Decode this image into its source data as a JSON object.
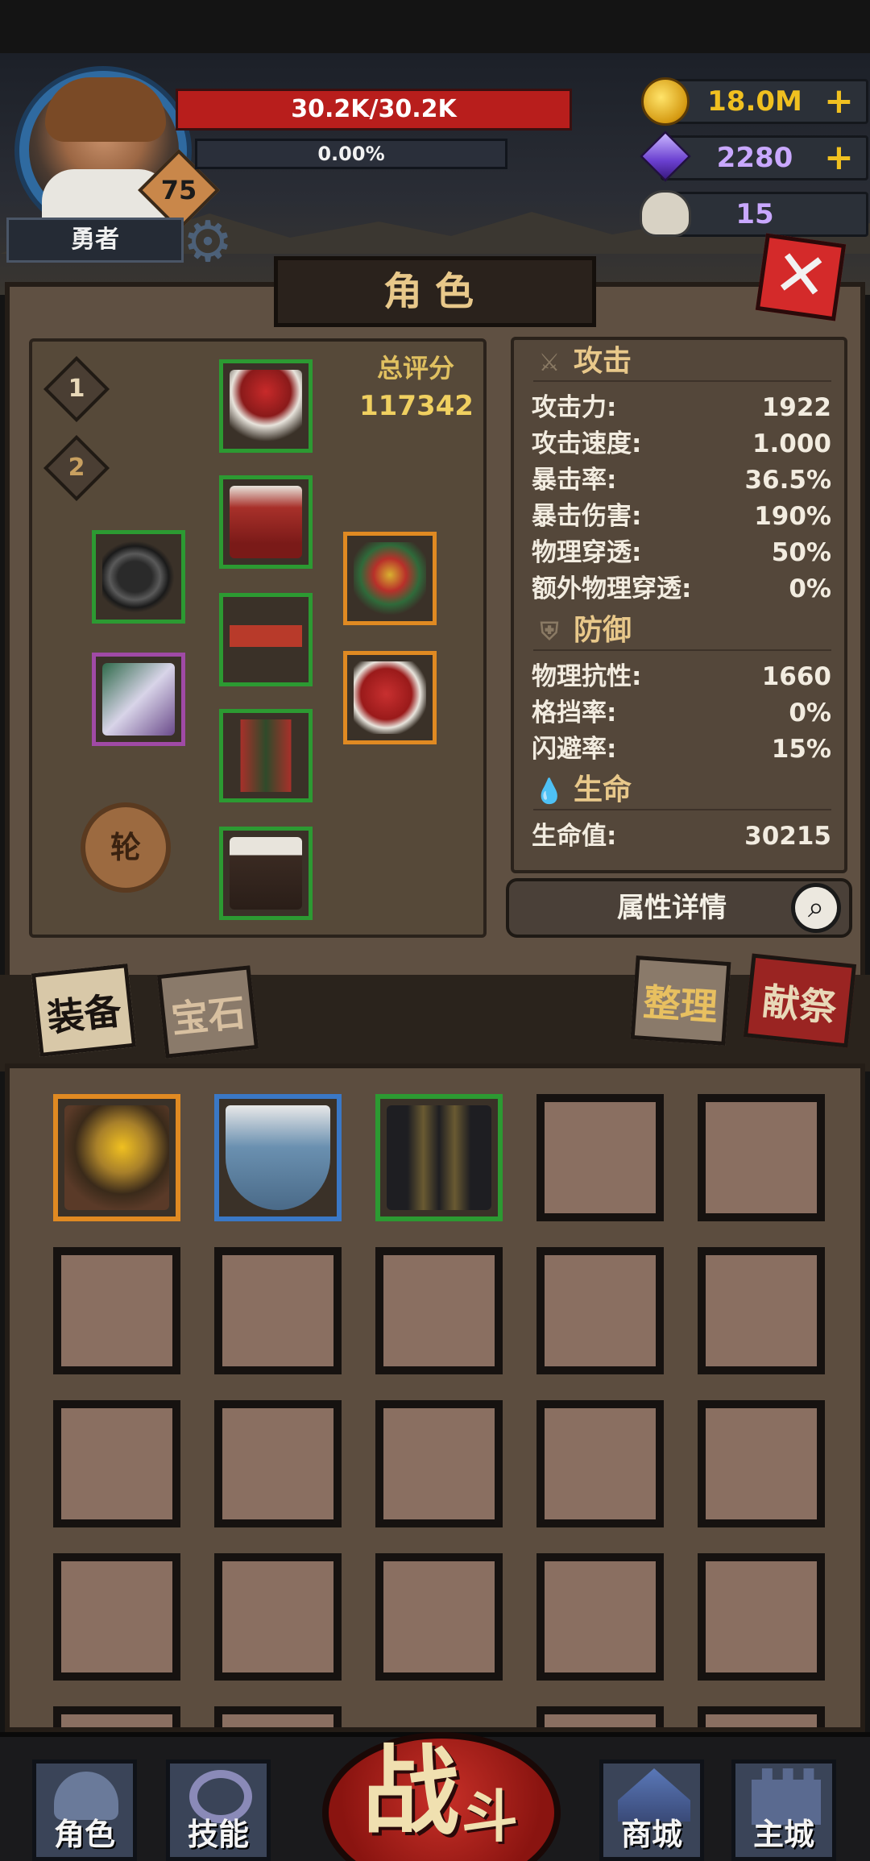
{
  "player": {
    "name": "勇者",
    "level": "75",
    "hp_text": "30.2K/30.2K",
    "hp_fraction": 1.0,
    "xp_text": "0.00%",
    "xp_fraction": 0.0
  },
  "currencies": {
    "gold": "18.0M",
    "gems": "2280",
    "skulls": "15"
  },
  "panel": {
    "title": "角色",
    "close_glyph": "✕"
  },
  "equipment": {
    "loadout_tabs": [
      "1",
      "2"
    ],
    "score_label": "总评分",
    "score_value": "117342",
    "rebirth_glyph": "轮"
  },
  "stats": {
    "attack_header": "攻击",
    "attack": [
      {
        "label": "攻击力:",
        "value": "1922"
      },
      {
        "label": "攻击速度:",
        "value": "1.000"
      },
      {
        "label": "暴击率:",
        "value": "36.5%"
      },
      {
        "label": "暴击伤害:",
        "value": "190%"
      },
      {
        "label": "物理穿透:",
        "value": "50%"
      },
      {
        "label": "额外物理穿透:",
        "value": "0%"
      }
    ],
    "defense_header": "防御",
    "defense": [
      {
        "label": "物理抗性:",
        "value": "1660"
      },
      {
        "label": "格挡率:",
        "value": "0%"
      },
      {
        "label": "闪避率:",
        "value": "15%"
      }
    ],
    "life_header": "生命",
    "life": [
      {
        "label": "生命值:",
        "value": "30215"
      }
    ],
    "details_button": "属性详情"
  },
  "tabs": {
    "equip": "装备",
    "gem": "宝石",
    "sort": "整理",
    "sacrifice": "献祭"
  },
  "inventory": {
    "rows": 4,
    "cols": 5,
    "items": [
      {
        "name": "sunflower-amulet",
        "rarity": "orange"
      },
      {
        "name": "kite-shield",
        "rarity": "blue"
      },
      {
        "name": "noble-coat",
        "rarity": "green"
      }
    ]
  },
  "nav": {
    "character": "角色",
    "skills": "技能",
    "fight_big": "战",
    "fight_small": "斗",
    "shop": "商城",
    "main_city": "主城"
  },
  "colors": {
    "green_rarity": "#2c9a32",
    "orange_rarity": "#e08a22",
    "blue_rarity": "#3a78c6",
    "gold_text": "#f0c020",
    "gem_text": "#c9a8ff"
  }
}
